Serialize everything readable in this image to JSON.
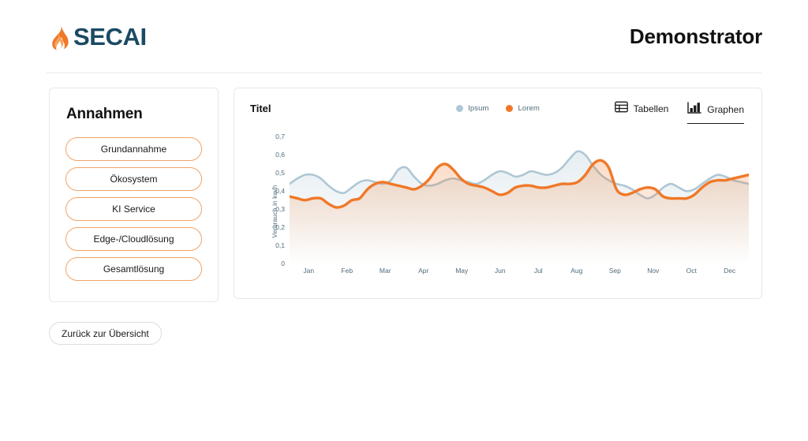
{
  "header": {
    "logo_text": "SECAI",
    "logo_icon": "flame-icon",
    "page_title": "Demonstrator",
    "brand_orange": "#F07828",
    "brand_navy": "#1B4A63"
  },
  "sidebar": {
    "title": "Annahmen",
    "items": [
      {
        "label": "Grundannahme"
      },
      {
        "label": "Ökosystem"
      },
      {
        "label": "KI Service"
      },
      {
        "label": "Edge-/Cloudlösung"
      },
      {
        "label": "Gesamtlösung"
      }
    ]
  },
  "back_button": {
    "label": "Zurück zur Übersicht"
  },
  "chart_panel": {
    "title": "Titel",
    "tabs": [
      {
        "label": "Tabellen",
        "icon": "table-icon",
        "active": false
      },
      {
        "label": "Graphen",
        "icon": "bar-chart-icon",
        "active": true
      }
    ]
  },
  "chart_data": {
    "type": "area",
    "title": "Titel",
    "xlabel": "",
    "ylabel": "Verbrauch in kw/h",
    "ylim": [
      0,
      0.75
    ],
    "grid": false,
    "legend_position": "top-center",
    "y_ticks": [
      "0",
      "0,1",
      "0,2",
      "0,3",
      "0,4",
      "0,5",
      "0,6",
      "0,7"
    ],
    "y_tick_values": [
      0,
      0.1,
      0.2,
      0.3,
      0.4,
      0.5,
      0.6,
      0.7
    ],
    "categories": [
      "Jan",
      "Feb",
      "Mar",
      "Apr",
      "May",
      "Jun",
      "Jul",
      "Aug",
      "Sep",
      "Nov",
      "Oct",
      "Dec"
    ],
    "colors": {
      "Ipsum": "#AEC7D4",
      "Lorem": "#F07828"
    },
    "series": [
      {
        "name": "Ipsum",
        "color": "#AEC7D4",
        "values": [
          0.44,
          0.47,
          0.49,
          0.49,
          0.47,
          0.43,
          0.4,
          0.39,
          0.42,
          0.45,
          0.46,
          0.45,
          0.44,
          0.46,
          0.52,
          0.53,
          0.48,
          0.44,
          0.43,
          0.44,
          0.46,
          0.47,
          0.46,
          0.45,
          0.44,
          0.46,
          0.49,
          0.51,
          0.5,
          0.48,
          0.49,
          0.51,
          0.5,
          0.49,
          0.5,
          0.53,
          0.58,
          0.62,
          0.6,
          0.54,
          0.49,
          0.46,
          0.44,
          0.43,
          0.41,
          0.38,
          0.36,
          0.38,
          0.42,
          0.44,
          0.42,
          0.4,
          0.41,
          0.44,
          0.47,
          0.49,
          0.48,
          0.46,
          0.45,
          0.44
        ]
      },
      {
        "name": "Lorem",
        "color": "#F07828",
        "values": [
          0.37,
          0.36,
          0.35,
          0.36,
          0.36,
          0.33,
          0.31,
          0.32,
          0.35,
          0.36,
          0.41,
          0.44,
          0.45,
          0.44,
          0.43,
          0.42,
          0.41,
          0.43,
          0.47,
          0.53,
          0.55,
          0.52,
          0.47,
          0.44,
          0.43,
          0.42,
          0.4,
          0.38,
          0.39,
          0.42,
          0.43,
          0.43,
          0.42,
          0.42,
          0.43,
          0.44,
          0.44,
          0.45,
          0.49,
          0.55,
          0.57,
          0.53,
          0.41,
          0.38,
          0.39,
          0.41,
          0.42,
          0.41,
          0.37,
          0.36,
          0.36,
          0.36,
          0.38,
          0.42,
          0.45,
          0.46,
          0.46,
          0.47,
          0.48,
          0.49
        ]
      }
    ]
  }
}
